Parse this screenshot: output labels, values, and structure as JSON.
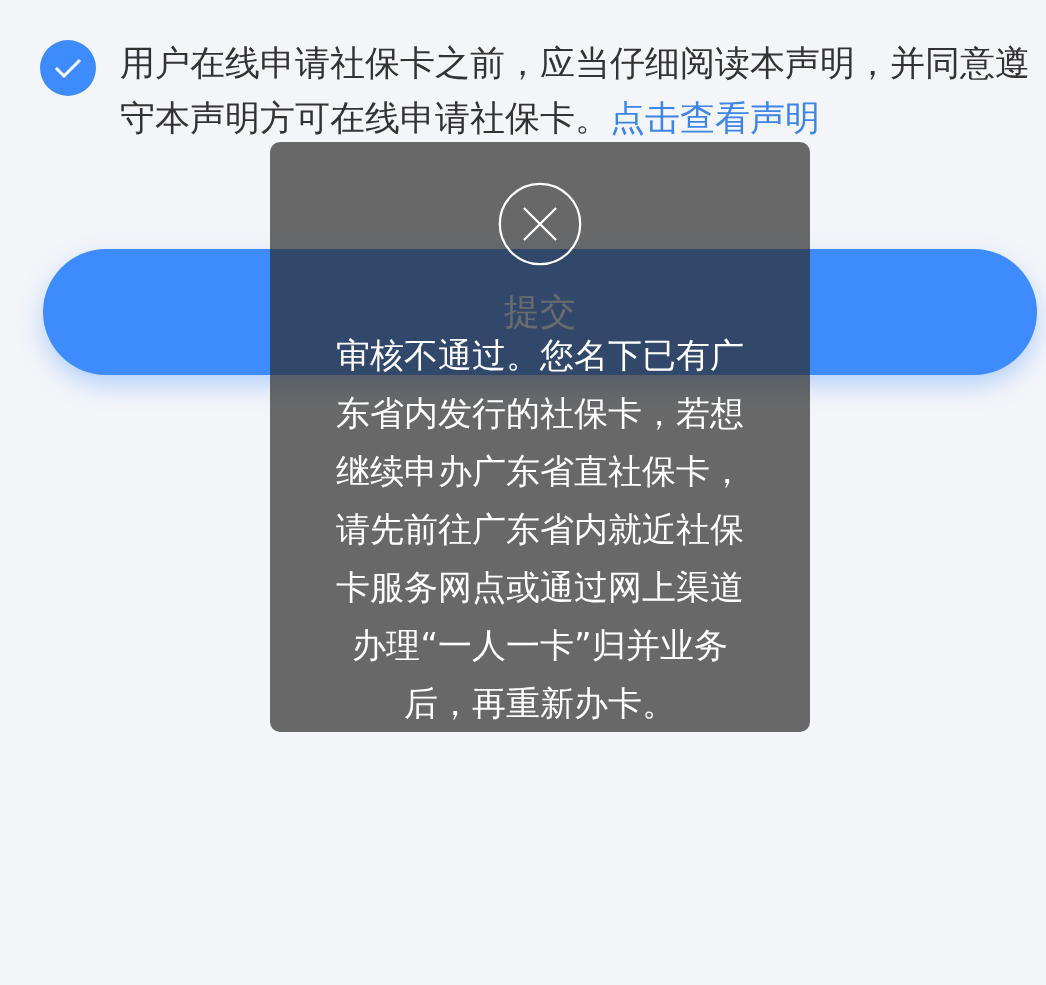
{
  "agreement": {
    "checked": true,
    "text": "用户在线申请社保卡之前，应当仔细阅读本声明，并同意遵守本声明方可在线申请社保卡。",
    "link": "点击查看声明"
  },
  "submit_button": {
    "label": "提交"
  },
  "toast": {
    "message": "审核不通过。您名下已有广东省内发行的社保卡，若想继续申办广东省直社保卡，请先前往广东省内就近社保卡服务网点或通过网上渠道办理“一人一卡”归并业务后，再重新办卡。"
  }
}
